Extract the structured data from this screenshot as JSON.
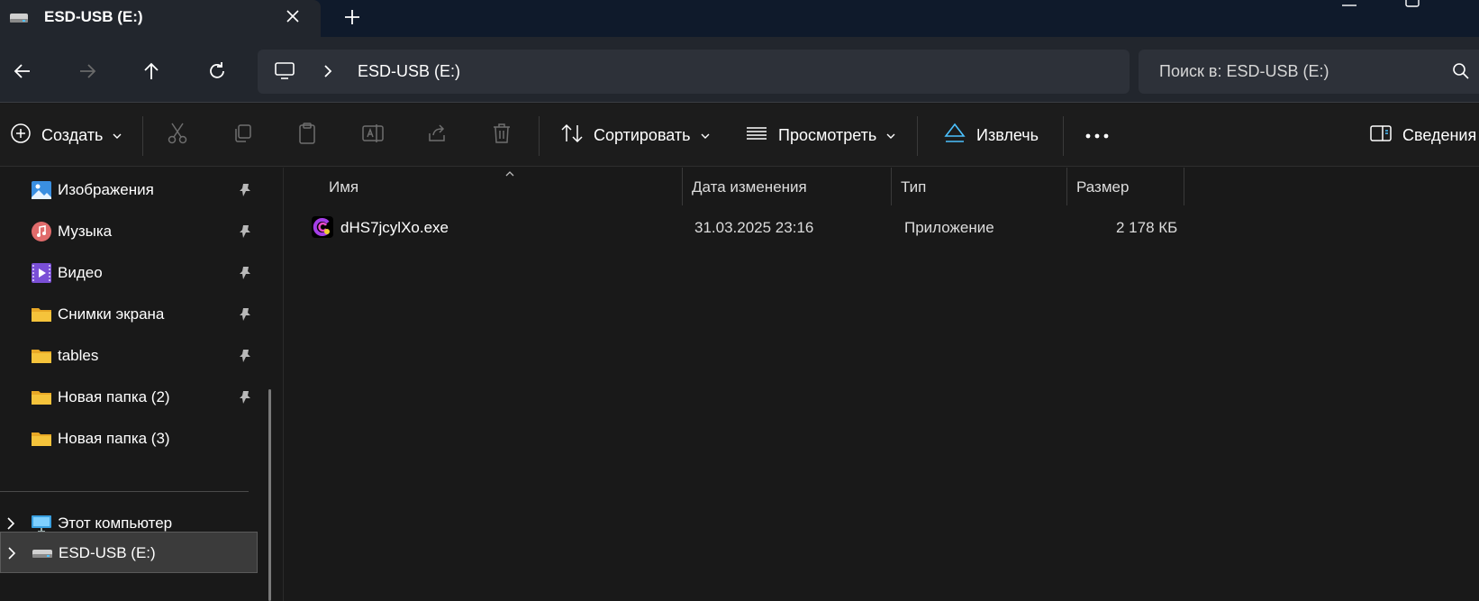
{
  "tab": {
    "title": "ESD-USB (E:)"
  },
  "address": {
    "crumb": "ESD-USB (E:)"
  },
  "search": {
    "placeholder": "Поиск в: ESD-USB (E:)"
  },
  "toolbar": {
    "create": "Создать",
    "sort": "Сортировать",
    "view": "Просмотреть",
    "eject": "Извлечь",
    "details": "Сведения"
  },
  "sidebar": {
    "items": [
      {
        "label": "Изображения",
        "icon": "pictures-icon",
        "pinned": true
      },
      {
        "label": "Музыка",
        "icon": "music-icon",
        "pinned": true
      },
      {
        "label": "Видео",
        "icon": "video-icon",
        "pinned": true
      },
      {
        "label": "Снимки экрана",
        "icon": "folder-icon",
        "pinned": true
      },
      {
        "label": "tables",
        "icon": "folder-icon",
        "pinned": true
      },
      {
        "label": "Новая папка (2)",
        "icon": "folder-icon",
        "pinned": true
      },
      {
        "label": "Новая папка (3)",
        "icon": "folder-icon",
        "pinned": false
      }
    ],
    "thispc": "Этот компьютер",
    "drive": "ESD-USB (E:)"
  },
  "columns": {
    "name": "Имя",
    "modified": "Дата изменения",
    "type": "Тип",
    "size": "Размер"
  },
  "files": [
    {
      "name": "dHS7jcylXo.exe",
      "modified": "31.03.2025 23:16",
      "type": "Приложение",
      "size": "2 178 КБ"
    }
  ],
  "colors": {
    "accent": "#4cc2ff",
    "folder": "#f5c33b",
    "background": "#191919"
  }
}
